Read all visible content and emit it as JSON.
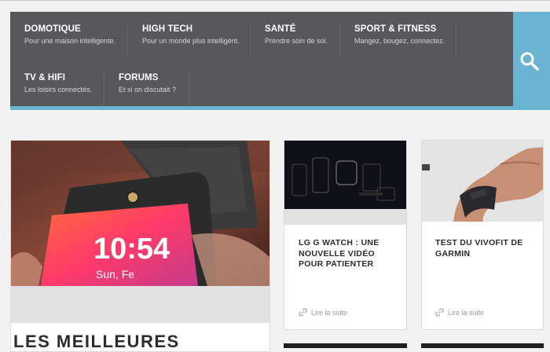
{
  "nav": {
    "items": [
      {
        "title": "DOMOTIQUE",
        "subtitle": "Pour une maison intelligente."
      },
      {
        "title": "HIGH TECH",
        "subtitle": "Pour un monde plus intelligent."
      },
      {
        "title": "SANTÉ",
        "subtitle": "Prendre soin de soi."
      },
      {
        "title": "SPORT & FITNESS",
        "subtitle": "Mangez, bougez, connectez."
      },
      {
        "title": "TV & HIFI",
        "subtitle": "Les loisirs connectés."
      },
      {
        "title": "FORUMS",
        "subtitle": "Et si on discutait ?"
      }
    ],
    "search_icon": "search-icon"
  },
  "featured": {
    "title": "LES MEILLEURES",
    "watch_time": "10:54",
    "watch_date": "Sun, Fe"
  },
  "cards": [
    {
      "title": "LG G WATCH : UNE NOUVELLE VIDÉO POUR PATIENTER",
      "more": "Lire la suite",
      "icon": "link-icon"
    },
    {
      "title": "TEST DU VIVOFIT DE GARMIN",
      "more": "Lire la suite",
      "icon": "link-icon"
    }
  ],
  "colors": {
    "nav_bg": "#58575c",
    "accent": "#69b3d3",
    "page_bg": "#f2f2f2"
  }
}
